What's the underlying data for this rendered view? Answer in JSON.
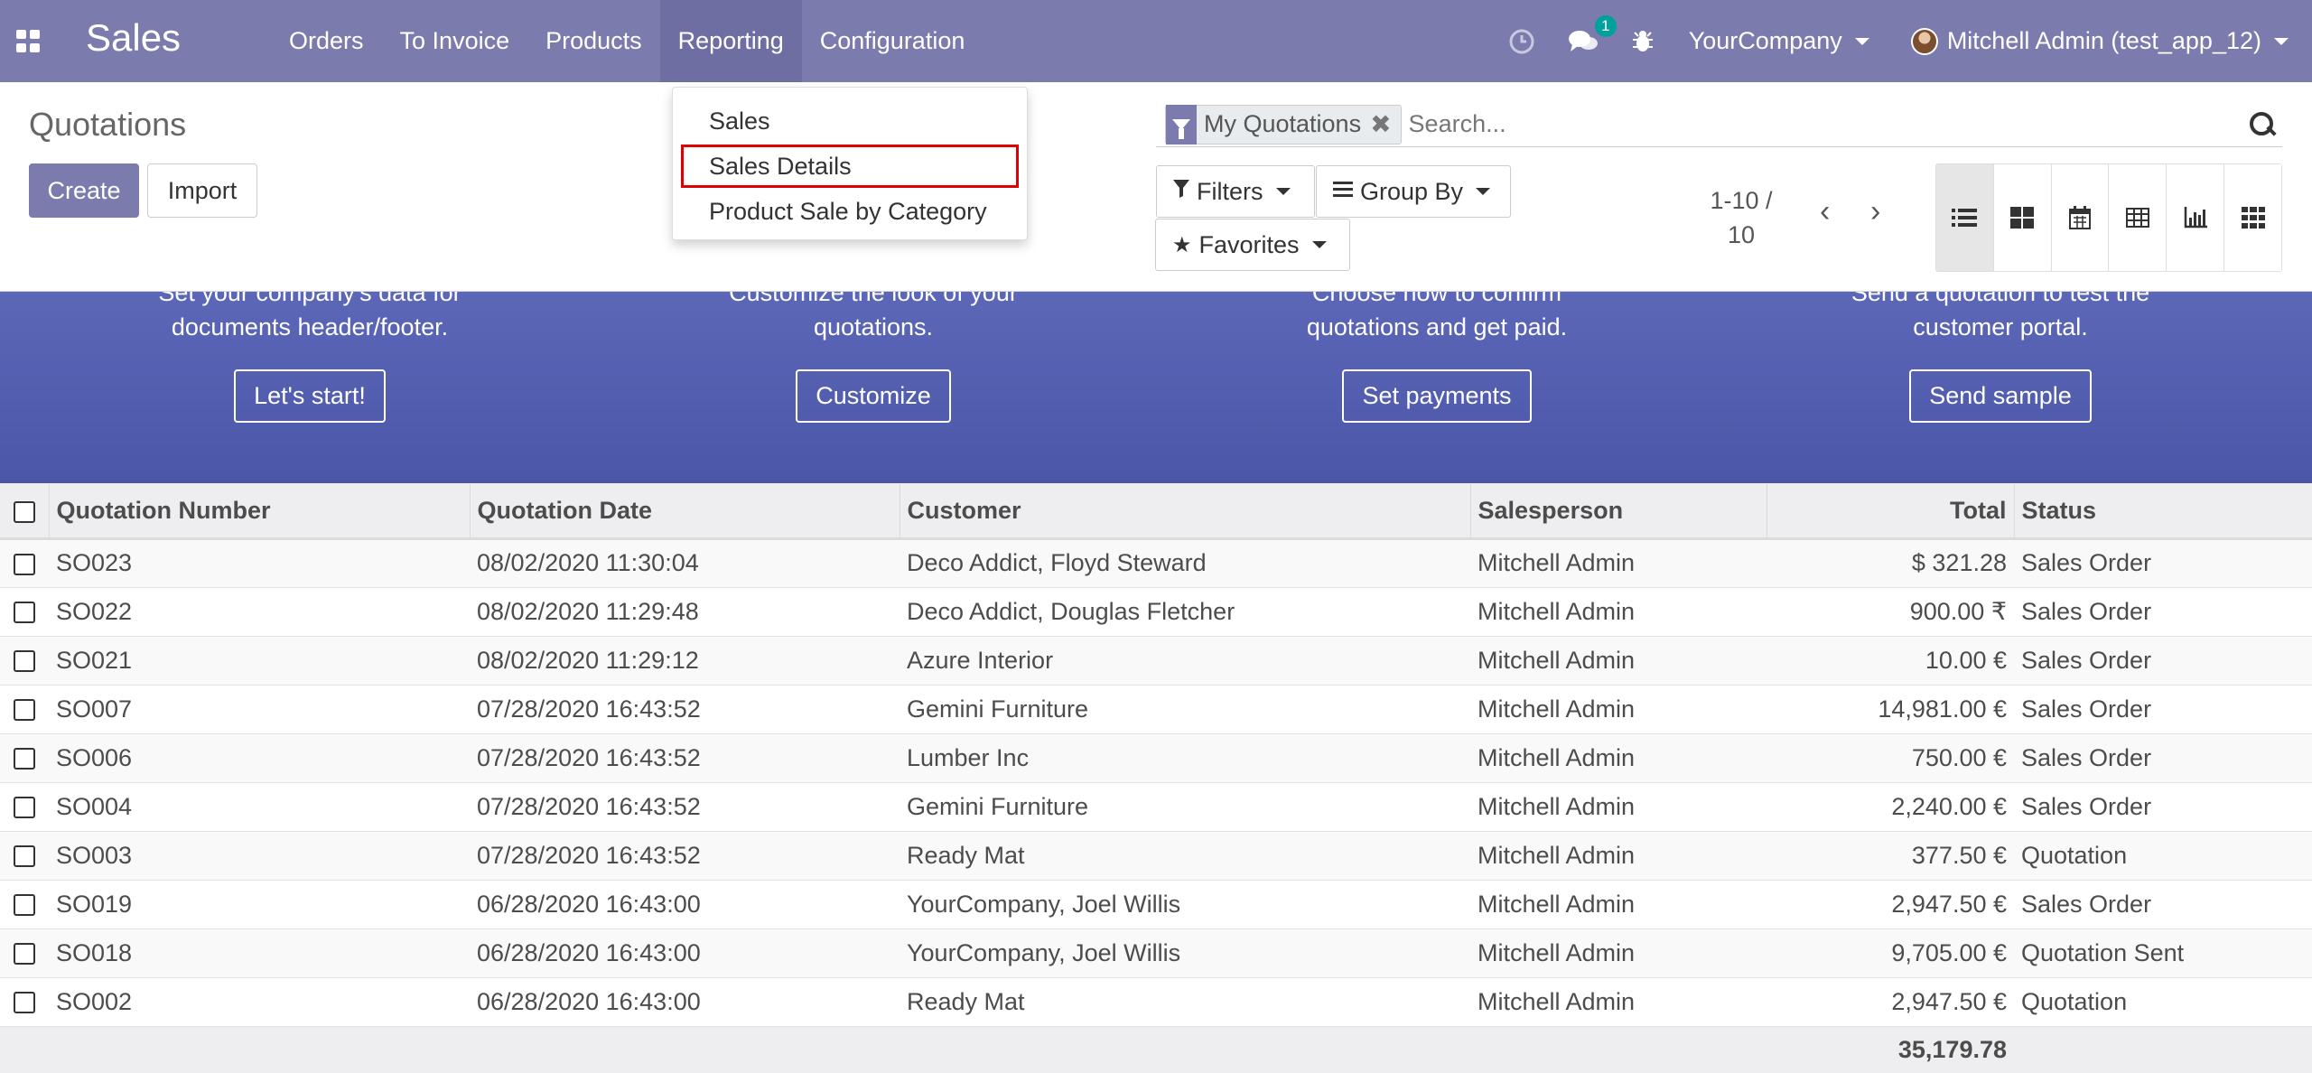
{
  "navbar": {
    "app_name": "Sales",
    "menu": [
      {
        "label": "Orders"
      },
      {
        "label": "To Invoice"
      },
      {
        "label": "Products"
      },
      {
        "label": "Reporting"
      },
      {
        "label": "Configuration"
      }
    ],
    "chat_badge": "1",
    "company": "YourCompany",
    "user": "Mitchell Admin (test_app_12)",
    "accent_color": "#7c7bad"
  },
  "reporting_menu": {
    "items": [
      {
        "label": "Sales"
      },
      {
        "label": "Sales Details"
      },
      {
        "label": "Product Sale by Category"
      }
    ],
    "highlighted": "Sales Details"
  },
  "control_panel": {
    "title": "Quotations",
    "create_label": "Create",
    "import_label": "Import",
    "search": {
      "facet": "My Quotations",
      "placeholder": "Search..."
    },
    "filters_label": "Filters",
    "group_by_label": "Group By",
    "favorites_label": "Favorites",
    "pager": {
      "range": "1-10 /",
      "total": "10"
    },
    "views": [
      "list",
      "kanban",
      "calendar",
      "pivot",
      "graph",
      "activity"
    ],
    "active_view": "list"
  },
  "banner": {
    "steps": [
      {
        "text_line1": "Set your company's data for",
        "text_line2": "documents header/footer.",
        "button": "Let's start!"
      },
      {
        "text_line1": "Customize the look of your",
        "text_line2": "quotations.",
        "button": "Customize"
      },
      {
        "text_line1": "Choose how to confirm",
        "text_line2": "quotations and get paid.",
        "button": "Set payments"
      },
      {
        "text_line1": "Send a quotation to test the",
        "text_line2": "customer portal.",
        "button": "Send sample"
      }
    ]
  },
  "table": {
    "columns": [
      "Quotation Number",
      "Quotation Date",
      "Customer",
      "Salesperson",
      "Total",
      "Status"
    ],
    "rows": [
      {
        "number": "SO023",
        "date": "08/02/2020 11:30:04",
        "customer": "Deco Addict, Floyd Steward",
        "salesperson": "Mitchell Admin",
        "total": "$ 321.28",
        "status": "Sales Order"
      },
      {
        "number": "SO022",
        "date": "08/02/2020 11:29:48",
        "customer": "Deco Addict, Douglas Fletcher",
        "salesperson": "Mitchell Admin",
        "total": "900.00 ₹",
        "status": "Sales Order"
      },
      {
        "number": "SO021",
        "date": "08/02/2020 11:29:12",
        "customer": "Azure Interior",
        "salesperson": "Mitchell Admin",
        "total": "10.00 €",
        "status": "Sales Order"
      },
      {
        "number": "SO007",
        "date": "07/28/2020 16:43:52",
        "customer": "Gemini Furniture",
        "salesperson": "Mitchell Admin",
        "total": "14,981.00 €",
        "status": "Sales Order"
      },
      {
        "number": "SO006",
        "date": "07/28/2020 16:43:52",
        "customer": "Lumber Inc",
        "salesperson": "Mitchell Admin",
        "total": "750.00 €",
        "status": "Sales Order"
      },
      {
        "number": "SO004",
        "date": "07/28/2020 16:43:52",
        "customer": "Gemini Furniture",
        "salesperson": "Mitchell Admin",
        "total": "2,240.00 €",
        "status": "Sales Order"
      },
      {
        "number": "SO003",
        "date": "07/28/2020 16:43:52",
        "customer": "Ready Mat",
        "salesperson": "Mitchell Admin",
        "total": "377.50 €",
        "status": "Quotation"
      },
      {
        "number": "SO019",
        "date": "06/28/2020 16:43:00",
        "customer": "YourCompany, Joel Willis",
        "salesperson": "Mitchell Admin",
        "total": "2,947.50 €",
        "status": "Sales Order"
      },
      {
        "number": "SO018",
        "date": "06/28/2020 16:43:00",
        "customer": "YourCompany, Joel Willis",
        "salesperson": "Mitchell Admin",
        "total": "9,705.00 €",
        "status": "Quotation Sent"
      },
      {
        "number": "SO002",
        "date": "06/28/2020 16:43:00",
        "customer": "Ready Mat",
        "salesperson": "Mitchell Admin",
        "total": "2,947.50 €",
        "status": "Quotation"
      }
    ],
    "footer_total": "35,179.78"
  }
}
